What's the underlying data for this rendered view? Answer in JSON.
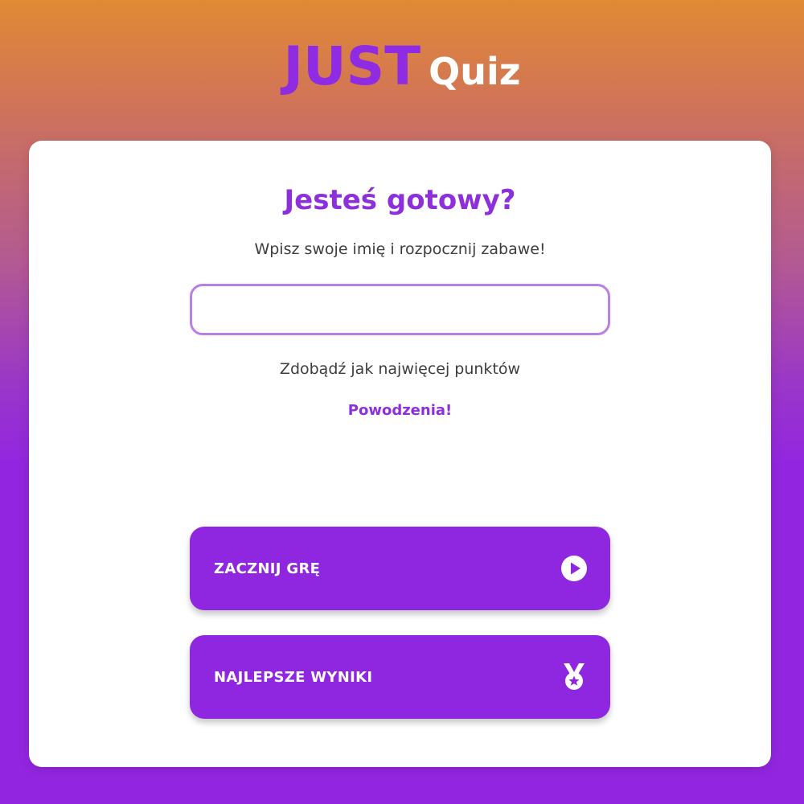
{
  "header": {
    "logo_part1": "JUST",
    "logo_part2": "Quiz"
  },
  "card": {
    "title": "Jesteś gotowy?",
    "subtitle": "Wpisz swoje imię i rozpocznij zabawe!",
    "name_input": {
      "value": "",
      "placeholder": ""
    },
    "info_text": "Zdobądź jak najwięcej punktów",
    "luck_text": "Powodzenia!"
  },
  "buttons": {
    "start": {
      "label": "ZACZNIJ GRĘ",
      "icon": "play-circle-icon"
    },
    "scores": {
      "label": "NAJLEPSZE WYNIKI",
      "icon": "medal-icon"
    }
  },
  "colors": {
    "accent_purple": "#8f26e0",
    "gradient_top": "#e08a34",
    "gradient_bottom": "#9226e0",
    "input_border": "#b97ee8"
  }
}
